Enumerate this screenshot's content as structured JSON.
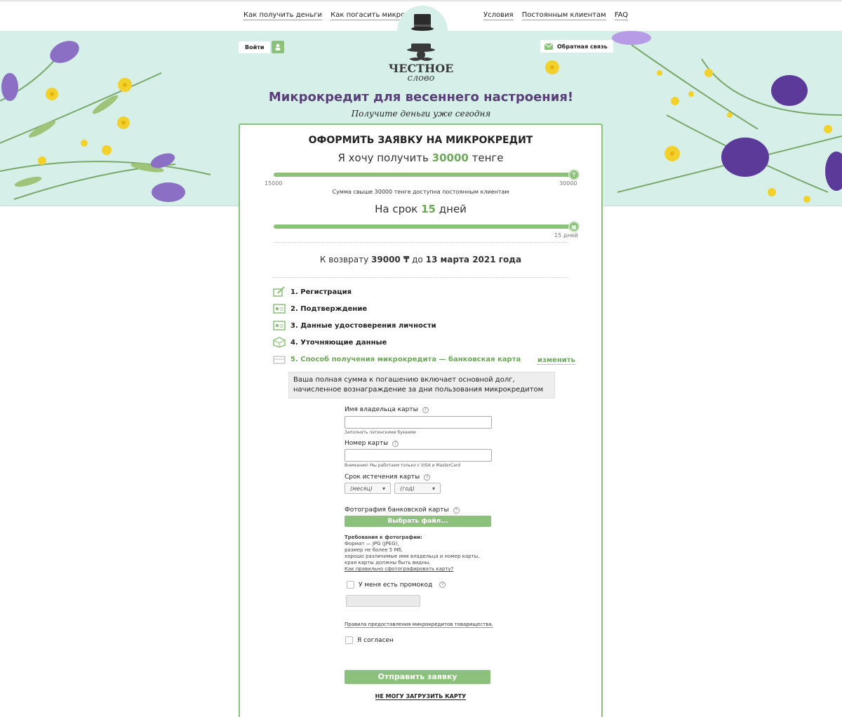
{
  "topnav": {
    "left": [
      "Как получить деньги",
      "Как погасить микрокредит"
    ],
    "right": [
      "Условия",
      "Постоянным клиентам",
      "FAQ"
    ]
  },
  "header": {
    "login_label": "Войти",
    "feedback_label": "Обратная связь",
    "logo_line1": "ЧЕСТНОЕ",
    "logo_line2": "слово",
    "headline": "Микрокредит для весеннего настроения!",
    "subline": "Получите деньги уже сегодня"
  },
  "form": {
    "title": "ОФОРМИТЬ ЗАЯВКУ НА МИКРОКРЕДИТ",
    "amount_prefix": "Я хочу получить",
    "amount_value": "30000",
    "amount_unit": "тенге",
    "amount_min": "15000",
    "amount_max": "30000",
    "amount_note": "Сумма свыше 30000 тенге доступна постоянным клиентам",
    "term_prefix": "На срок",
    "term_value": "15",
    "term_unit": "дней",
    "term_tick": "15 дней",
    "repay_prefix": "К возврату",
    "repay_amount": "39000 ₸",
    "repay_mid": "до",
    "repay_date": "13 марта 2021 года",
    "steps": [
      "1. Регистрация",
      "2. Подтверждение",
      "3. Данные удостоверения личности",
      "4. Уточняющие данные",
      "5. Способ получения микрокредита — банковская карта"
    ],
    "change_link": "изменить",
    "info": "Ваша полная сумма к погашению включает основной долг, начисленное вознаграждение за дни пользования микрокредитом",
    "card_holder_label": "Имя владельца карты",
    "card_holder_value": "",
    "card_holder_hint": "Заполнять латинскими буквами",
    "card_number_label": "Номер карты",
    "card_number_value": "",
    "card_number_hint": "Внимание! Мы работаем только с VISA и MasterCard",
    "expiry_label": "Срок истечения карты",
    "month_select": "(месяц)",
    "year_select": "(год)",
    "photo_label": "Фотография банковской карты",
    "file_button": "Выбрать файл...",
    "photo_req_title": "Требования к фотографии:",
    "photo_req_lines": [
      "Формат — JPG (JPEG),",
      "размер не более 5 Мб,",
      "хорошо различимые имя владельца и номер карты,",
      "края карты должны быть видны."
    ],
    "photo_req_link": "Как правильно сфотографировать карту?",
    "promo_label": "У меня есть промокод",
    "promo_value": "",
    "rules_link": "Правила предоставления микрокредитов товарищества.",
    "agree_label": "Я согласен",
    "submit_label": "Отправить заявку",
    "cant_load": "НЕ МОГУ ЗАГРУЗИТЬ КАРТУ"
  },
  "colors": {
    "accent": "#8bc17a",
    "accent_text": "#6ea85a",
    "headline": "#5a3d7a",
    "hero_bg": "#d6efe9"
  }
}
